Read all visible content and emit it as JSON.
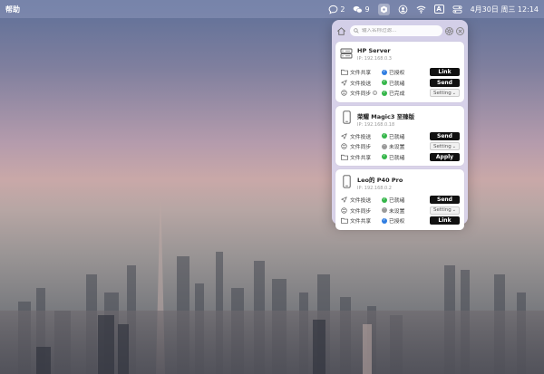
{
  "menubar": {
    "app_menu": "帮助",
    "chat_count": "2",
    "wechat_count": "9",
    "input_method": "A",
    "datetime": "4月30日 周三  12:14"
  },
  "panel": {
    "search_placeholder": "输入名称过滤...",
    "devices": [
      {
        "name": "HP Server",
        "ip": "IP: 192.168.0.3",
        "icon": "server-icon",
        "services": [
          {
            "label": "文件共享",
            "icon": "folder-icon",
            "status": "已授权",
            "status_type": "blue",
            "action": "Link",
            "action_type": "button"
          },
          {
            "label": "文件投送",
            "icon": "send-icon",
            "status": "已就绪",
            "status_type": "green",
            "action": "Send",
            "action_type": "button"
          },
          {
            "label": "文件同步",
            "icon": "sync-icon",
            "status": "已完成",
            "status_type": "green",
            "action": "Setting",
            "action_type": "select",
            "info": true
          }
        ]
      },
      {
        "name": "荣耀 Magic3 至臻版",
        "ip": "IP: 192.168.0.18",
        "icon": "phone-icon",
        "services": [
          {
            "label": "文件投送",
            "icon": "send-icon",
            "status": "已就绪",
            "status_type": "green",
            "action": "Send",
            "action_type": "button"
          },
          {
            "label": "文件同步",
            "icon": "sync-icon",
            "status": "未设置",
            "status_type": "gray",
            "action": "Setting",
            "action_type": "select"
          },
          {
            "label": "文件共享",
            "icon": "folder-icon",
            "status": "已就绪",
            "status_type": "green",
            "action": "Apply",
            "action_type": "button"
          }
        ]
      },
      {
        "name": "Leo的 P40 Pro",
        "ip": "IP: 192.168.0.2",
        "icon": "phone-icon",
        "services": [
          {
            "label": "文件投送",
            "icon": "send-icon",
            "status": "已就绪",
            "status_type": "green",
            "action": "Send",
            "action_type": "button"
          },
          {
            "label": "文件同步",
            "icon": "sync-icon",
            "status": "未设置",
            "status_type": "gray",
            "action": "Setting",
            "action_type": "select"
          },
          {
            "label": "文件共享",
            "icon": "folder-icon",
            "status": "已授权",
            "status_type": "blue",
            "action": "Link",
            "action_type": "button"
          }
        ]
      }
    ]
  },
  "colors": {
    "status_green": "#35b64a",
    "status_blue": "#2f7de1",
    "status_gray": "#9a9a9a",
    "button_bg": "#111111"
  }
}
